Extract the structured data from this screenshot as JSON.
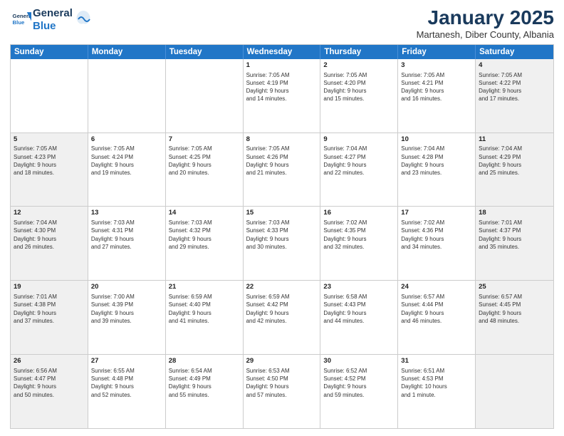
{
  "header": {
    "logo_general": "General",
    "logo_blue": "Blue",
    "month_year": "January 2025",
    "location": "Martanesh, Diber County, Albania"
  },
  "weekdays": [
    "Sunday",
    "Monday",
    "Tuesday",
    "Wednesday",
    "Thursday",
    "Friday",
    "Saturday"
  ],
  "weeks": [
    [
      {
        "day": "",
        "info": "",
        "shaded": false
      },
      {
        "day": "",
        "info": "",
        "shaded": false
      },
      {
        "day": "",
        "info": "",
        "shaded": false
      },
      {
        "day": "1",
        "info": "Sunrise: 7:05 AM\nSunset: 4:19 PM\nDaylight: 9 hours\nand 14 minutes.",
        "shaded": false
      },
      {
        "day": "2",
        "info": "Sunrise: 7:05 AM\nSunset: 4:20 PM\nDaylight: 9 hours\nand 15 minutes.",
        "shaded": false
      },
      {
        "day": "3",
        "info": "Sunrise: 7:05 AM\nSunset: 4:21 PM\nDaylight: 9 hours\nand 16 minutes.",
        "shaded": false
      },
      {
        "day": "4",
        "info": "Sunrise: 7:05 AM\nSunset: 4:22 PM\nDaylight: 9 hours\nand 17 minutes.",
        "shaded": true
      }
    ],
    [
      {
        "day": "5",
        "info": "Sunrise: 7:05 AM\nSunset: 4:23 PM\nDaylight: 9 hours\nand 18 minutes.",
        "shaded": true
      },
      {
        "day": "6",
        "info": "Sunrise: 7:05 AM\nSunset: 4:24 PM\nDaylight: 9 hours\nand 19 minutes.",
        "shaded": false
      },
      {
        "day": "7",
        "info": "Sunrise: 7:05 AM\nSunset: 4:25 PM\nDaylight: 9 hours\nand 20 minutes.",
        "shaded": false
      },
      {
        "day": "8",
        "info": "Sunrise: 7:05 AM\nSunset: 4:26 PM\nDaylight: 9 hours\nand 21 minutes.",
        "shaded": false
      },
      {
        "day": "9",
        "info": "Sunrise: 7:04 AM\nSunset: 4:27 PM\nDaylight: 9 hours\nand 22 minutes.",
        "shaded": false
      },
      {
        "day": "10",
        "info": "Sunrise: 7:04 AM\nSunset: 4:28 PM\nDaylight: 9 hours\nand 23 minutes.",
        "shaded": false
      },
      {
        "day": "11",
        "info": "Sunrise: 7:04 AM\nSunset: 4:29 PM\nDaylight: 9 hours\nand 25 minutes.",
        "shaded": true
      }
    ],
    [
      {
        "day": "12",
        "info": "Sunrise: 7:04 AM\nSunset: 4:30 PM\nDaylight: 9 hours\nand 26 minutes.",
        "shaded": true
      },
      {
        "day": "13",
        "info": "Sunrise: 7:03 AM\nSunset: 4:31 PM\nDaylight: 9 hours\nand 27 minutes.",
        "shaded": false
      },
      {
        "day": "14",
        "info": "Sunrise: 7:03 AM\nSunset: 4:32 PM\nDaylight: 9 hours\nand 29 minutes.",
        "shaded": false
      },
      {
        "day": "15",
        "info": "Sunrise: 7:03 AM\nSunset: 4:33 PM\nDaylight: 9 hours\nand 30 minutes.",
        "shaded": false
      },
      {
        "day": "16",
        "info": "Sunrise: 7:02 AM\nSunset: 4:35 PM\nDaylight: 9 hours\nand 32 minutes.",
        "shaded": false
      },
      {
        "day": "17",
        "info": "Sunrise: 7:02 AM\nSunset: 4:36 PM\nDaylight: 9 hours\nand 34 minutes.",
        "shaded": false
      },
      {
        "day": "18",
        "info": "Sunrise: 7:01 AM\nSunset: 4:37 PM\nDaylight: 9 hours\nand 35 minutes.",
        "shaded": true
      }
    ],
    [
      {
        "day": "19",
        "info": "Sunrise: 7:01 AM\nSunset: 4:38 PM\nDaylight: 9 hours\nand 37 minutes.",
        "shaded": true
      },
      {
        "day": "20",
        "info": "Sunrise: 7:00 AM\nSunset: 4:39 PM\nDaylight: 9 hours\nand 39 minutes.",
        "shaded": false
      },
      {
        "day": "21",
        "info": "Sunrise: 6:59 AM\nSunset: 4:40 PM\nDaylight: 9 hours\nand 41 minutes.",
        "shaded": false
      },
      {
        "day": "22",
        "info": "Sunrise: 6:59 AM\nSunset: 4:42 PM\nDaylight: 9 hours\nand 42 minutes.",
        "shaded": false
      },
      {
        "day": "23",
        "info": "Sunrise: 6:58 AM\nSunset: 4:43 PM\nDaylight: 9 hours\nand 44 minutes.",
        "shaded": false
      },
      {
        "day": "24",
        "info": "Sunrise: 6:57 AM\nSunset: 4:44 PM\nDaylight: 9 hours\nand 46 minutes.",
        "shaded": false
      },
      {
        "day": "25",
        "info": "Sunrise: 6:57 AM\nSunset: 4:45 PM\nDaylight: 9 hours\nand 48 minutes.",
        "shaded": true
      }
    ],
    [
      {
        "day": "26",
        "info": "Sunrise: 6:56 AM\nSunset: 4:47 PM\nDaylight: 9 hours\nand 50 minutes.",
        "shaded": true
      },
      {
        "day": "27",
        "info": "Sunrise: 6:55 AM\nSunset: 4:48 PM\nDaylight: 9 hours\nand 52 minutes.",
        "shaded": false
      },
      {
        "day": "28",
        "info": "Sunrise: 6:54 AM\nSunset: 4:49 PM\nDaylight: 9 hours\nand 55 minutes.",
        "shaded": false
      },
      {
        "day": "29",
        "info": "Sunrise: 6:53 AM\nSunset: 4:50 PM\nDaylight: 9 hours\nand 57 minutes.",
        "shaded": false
      },
      {
        "day": "30",
        "info": "Sunrise: 6:52 AM\nSunset: 4:52 PM\nDaylight: 9 hours\nand 59 minutes.",
        "shaded": false
      },
      {
        "day": "31",
        "info": "Sunrise: 6:51 AM\nSunset: 4:53 PM\nDaylight: 10 hours\nand 1 minute.",
        "shaded": false
      },
      {
        "day": "",
        "info": "",
        "shaded": true
      }
    ]
  ]
}
